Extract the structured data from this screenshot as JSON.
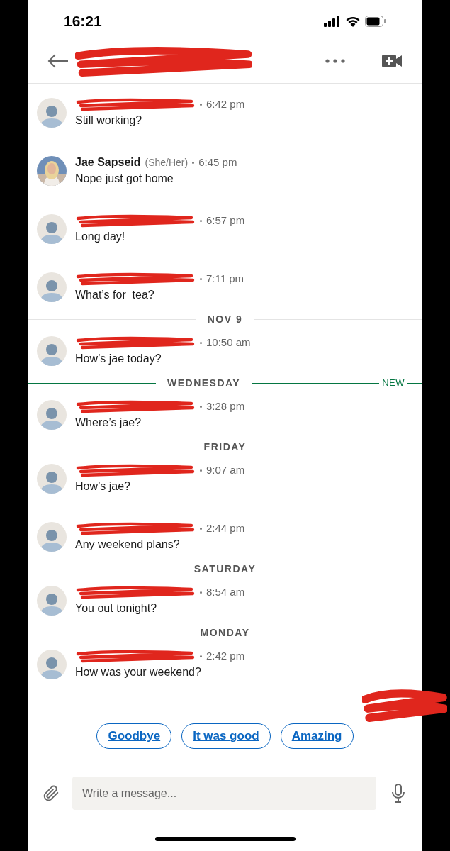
{
  "status_bar": {
    "time": "16:21"
  },
  "header": {
    "title_redacted": true
  },
  "items": [
    {
      "kind": "message",
      "redacted": true,
      "photo": false,
      "time": "6:42 pm",
      "text": "Still working?"
    },
    {
      "kind": "message",
      "redacted": false,
      "name": "Jae Sapseid",
      "pronouns": "(She/Her)",
      "photo": true,
      "time": "6:45 pm",
      "text": "Nope just got home"
    },
    {
      "kind": "message",
      "redacted": true,
      "photo": false,
      "time": "6:57 pm",
      "text": "Long day!"
    },
    {
      "kind": "message",
      "redacted": true,
      "photo": false,
      "time": "7:11 pm",
      "text": "What’s for  tea?"
    },
    {
      "kind": "divider",
      "label": "NOV 9",
      "new": false
    },
    {
      "kind": "message",
      "redacted": true,
      "photo": false,
      "time": "10:50 am",
      "text": "How’s jae today?"
    },
    {
      "kind": "divider",
      "label": "WEDNESDAY",
      "new": true,
      "new_label": "NEW"
    },
    {
      "kind": "message",
      "redacted": true,
      "photo": false,
      "time": "3:28 pm",
      "text": "Where’s jae?"
    },
    {
      "kind": "divider",
      "label": "FRIDAY",
      "new": false
    },
    {
      "kind": "message",
      "redacted": true,
      "photo": false,
      "time": "9:07 am",
      "text": "How’s jae?"
    },
    {
      "kind": "message",
      "redacted": true,
      "photo": false,
      "time": "2:44 pm",
      "text": "Any weekend plans?"
    },
    {
      "kind": "divider",
      "label": "SATURDAY",
      "new": false
    },
    {
      "kind": "message",
      "redacted": true,
      "photo": false,
      "time": "8:54 am",
      "text": "You out tonight?"
    },
    {
      "kind": "divider",
      "label": "MONDAY",
      "new": false
    },
    {
      "kind": "message",
      "redacted": true,
      "photo": false,
      "time": "2:42 pm",
      "text": "How was your weekend?"
    }
  ],
  "seen_redacted": true,
  "suggestions": [
    "Goodbye",
    "It was good",
    "Amazing"
  ],
  "composer": {
    "placeholder": "Write a message..."
  }
}
